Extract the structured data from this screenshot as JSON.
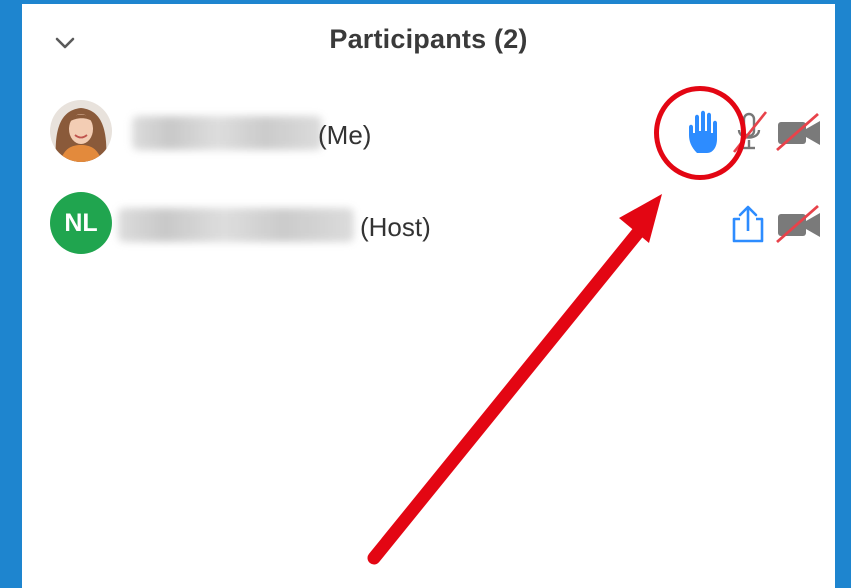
{
  "panel": {
    "title": "Participants",
    "count": "(2)"
  },
  "participants": [
    {
      "name_blurred": true,
      "role": "(Me)",
      "avatar": "photo",
      "icons": [
        "raised-hand-icon",
        "muted-microphone-icon",
        "video-off-icon"
      ]
    },
    {
      "name_blurred": true,
      "initials": "NL",
      "role": "(Host)",
      "avatar_color": "#20a54f",
      "icons": [
        "share-screen-icon",
        "video-off-icon"
      ]
    }
  ],
  "colors": {
    "frame": "#1e85cf",
    "accent_blue": "#2d8cff",
    "annotation_red": "#e30613",
    "initials_bg": "#20a54f"
  }
}
